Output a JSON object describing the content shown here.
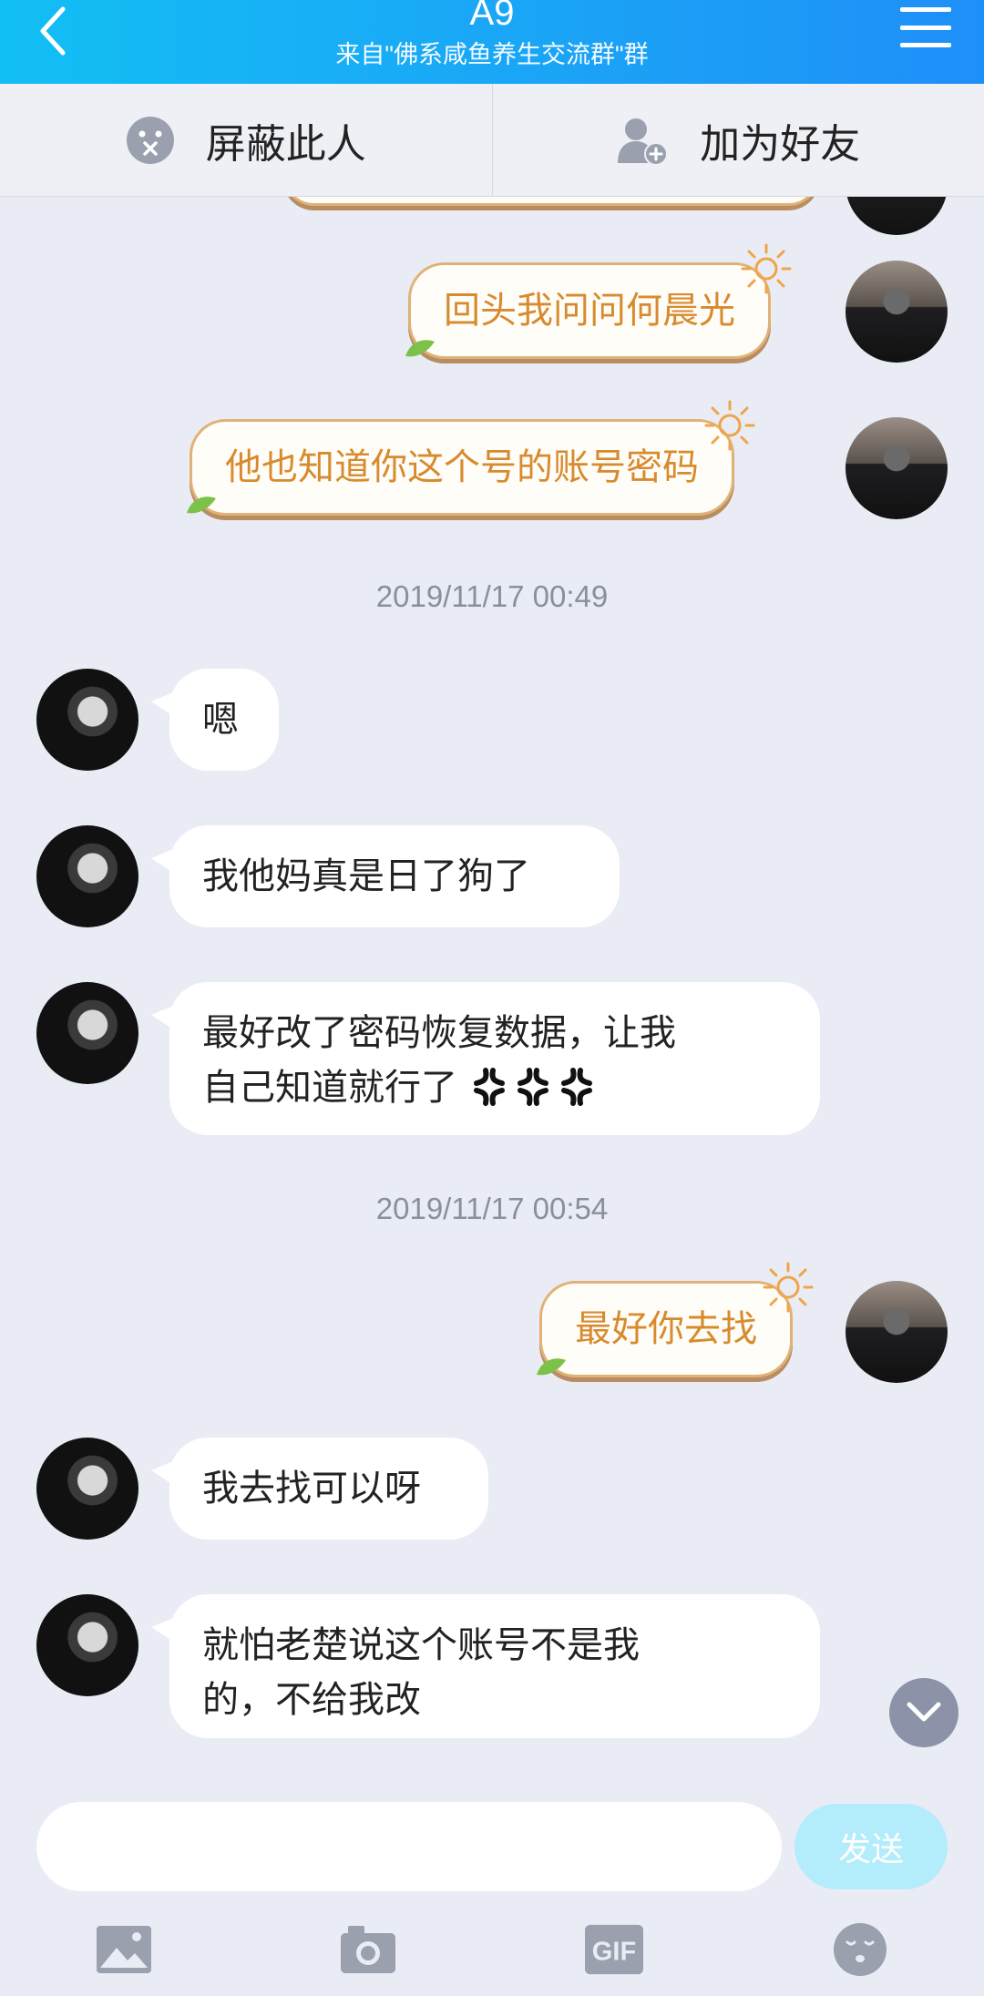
{
  "header": {
    "title": "A9",
    "subtitle": "来自\"佛系咸鱼养生交流群\"群"
  },
  "actions": {
    "block_label": "屏蔽此人",
    "add_friend_label": "加为好友"
  },
  "messages": [
    {
      "side": "right",
      "style": "sun",
      "text": "回头我问问何晨光"
    },
    {
      "side": "right",
      "style": "sun",
      "text": "他也知道你这个号的账号密码"
    },
    {
      "type": "timestamp",
      "text": "2019/11/17 00:49"
    },
    {
      "side": "left",
      "text": "嗯"
    },
    {
      "side": "left",
      "text": "我他妈真是日了狗了"
    },
    {
      "side": "left",
      "text_line1": "最好改了密码恢复数据，让我",
      "text_line2": "自己知道就行了",
      "emoji": "anger-emoji"
    },
    {
      "type": "timestamp",
      "text": "2019/11/17 00:54"
    },
    {
      "side": "right",
      "style": "sun",
      "text": "最好你去找"
    },
    {
      "side": "left",
      "text": "我去找可以呀"
    },
    {
      "side": "left",
      "text_line1": "就怕老楚说这个账号不是我",
      "text_line2": "的，不给我改"
    }
  ],
  "composer": {
    "input_value": "",
    "send_label": "发送"
  },
  "toolbar": [
    "image-icon",
    "camera-icon",
    "gif-icon",
    "emoji-icon"
  ],
  "colors": {
    "header_gradient_start": "#12bff4",
    "header_gradient_end": "#1e8ff8",
    "background": "#e9ecf4",
    "sun_bubble_text": "#d88a2e",
    "send_button": "#b3ecfb"
  }
}
